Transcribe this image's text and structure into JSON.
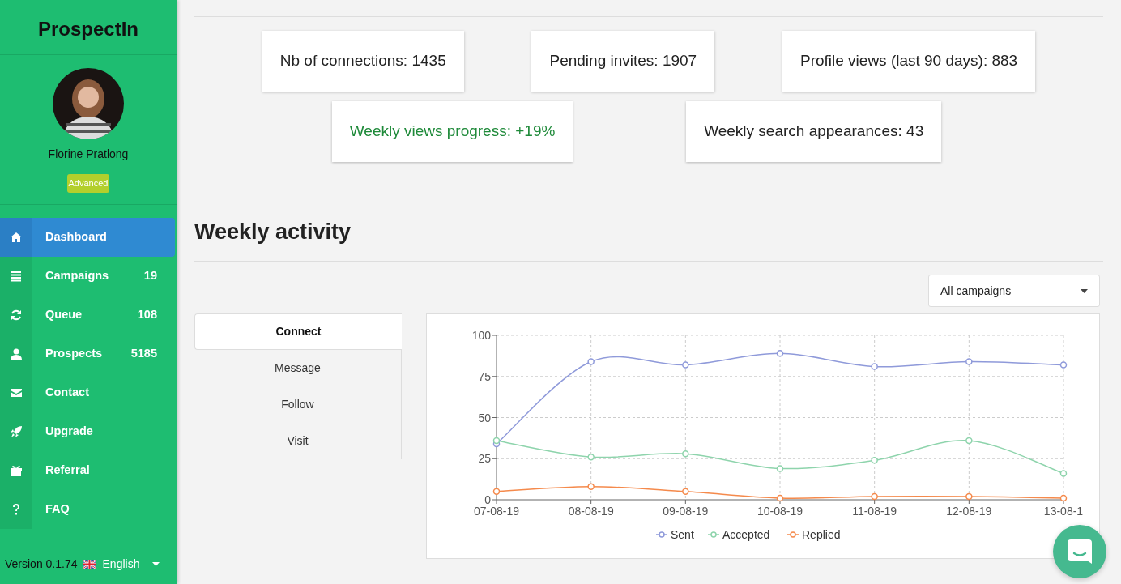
{
  "sidebar": {
    "brand": "ProspectIn",
    "user": {
      "name": "Florine Pratlong",
      "plan": "Advanced"
    },
    "items": [
      {
        "label": "Dashboard",
        "selected": true
      },
      {
        "label": "Campaigns",
        "count": "19",
        "selected": false
      },
      {
        "label": "Queue",
        "count": "108",
        "selected": false
      },
      {
        "label": "Prospects",
        "count": "5185",
        "selected": false
      },
      {
        "label": "Contact",
        "selected": false
      },
      {
        "label": "Upgrade",
        "selected": false
      },
      {
        "label": "Referral",
        "selected": false
      },
      {
        "label": "FAQ",
        "selected": false
      }
    ],
    "version": "Version 0.1.74",
    "language": "English"
  },
  "stats": [
    [
      {
        "text": "Nb of connections: 1435",
        "kind": "plain"
      },
      {
        "text": "Pending invites: 1907",
        "kind": "plain"
      },
      {
        "text": "Profile views (last 90 days): 883",
        "kind": "plain"
      }
    ],
    [
      {
        "text": "Weekly views progress: +19%",
        "kind": "positive"
      },
      {
        "text": "Weekly search appearances: 43",
        "kind": "plain"
      }
    ]
  ],
  "activity": {
    "title": "Weekly activity",
    "filter": "All campaigns",
    "tabs": [
      {
        "label": "Connect",
        "selected": true
      },
      {
        "label": "Message",
        "selected": false
      },
      {
        "label": "Follow",
        "selected": false
      },
      {
        "label": "Visit",
        "selected": false
      }
    ],
    "chart_data": {
      "type": "line",
      "categories": [
        "07-08-19",
        "08-08-19",
        "09-08-19",
        "10-08-19",
        "11-08-19",
        "12-08-19",
        "13-08-1"
      ],
      "ylim": [
        0,
        100
      ],
      "yticks": [
        0,
        25,
        50,
        75,
        100
      ],
      "grid": true,
      "legend": "bottom",
      "series": [
        {
          "name": "Sent",
          "color": "#8f9ada",
          "marker": "circle",
          "values": [
            34,
            84,
            82,
            89,
            81,
            84,
            82
          ]
        },
        {
          "name": "Accepted",
          "color": "#8ed4ac",
          "marker": "circle",
          "values": [
            36,
            26,
            28,
            19,
            24,
            36,
            16
          ]
        },
        {
          "name": "Replied",
          "color": "#f58a4c",
          "marker": "circle",
          "values": [
            5,
            8,
            5,
            1,
            2,
            2,
            1
          ]
        }
      ]
    }
  }
}
